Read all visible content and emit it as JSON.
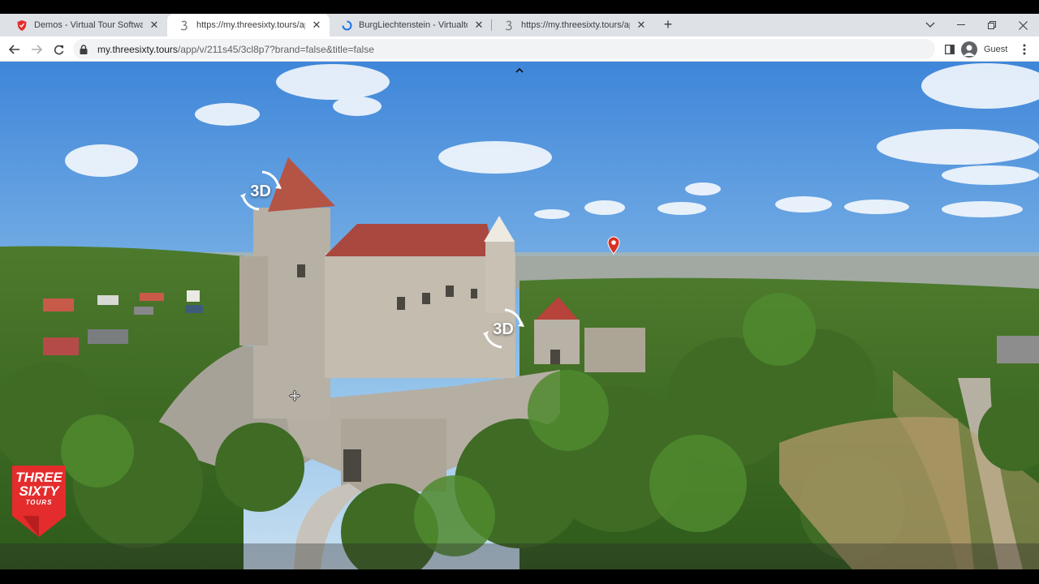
{
  "browser": {
    "tabs": [
      {
        "title": "Demos - Virtual Tour Software - ",
        "favicon": "shield-icon",
        "active": false
      },
      {
        "title": "https://my.threesixty.tours/app/v",
        "favicon": "threesixty-icon",
        "active": true
      },
      {
        "title": "BurgLiechtenstein - Virtualtour -",
        "favicon": "loading-spinner-icon",
        "active": false
      },
      {
        "title": "https://my.threesixty.tours/app/v",
        "favicon": "threesixty-icon",
        "active": false
      }
    ],
    "new_tab_label": "+",
    "url_host": "my.threesixty.tours",
    "url_path": "/app/v/211s45/3cl8p7?brand=false&title=false",
    "profile_label": "Guest"
  },
  "viewer": {
    "hotspots": [
      {
        "label": "3D"
      },
      {
        "label": "3D"
      }
    ],
    "logo": {
      "line1": "THREE",
      "line2": "SIXTY",
      "line3": "TOURS"
    },
    "colors": {
      "brand_red": "#e42c2c",
      "pin_red": "#d93025"
    }
  }
}
